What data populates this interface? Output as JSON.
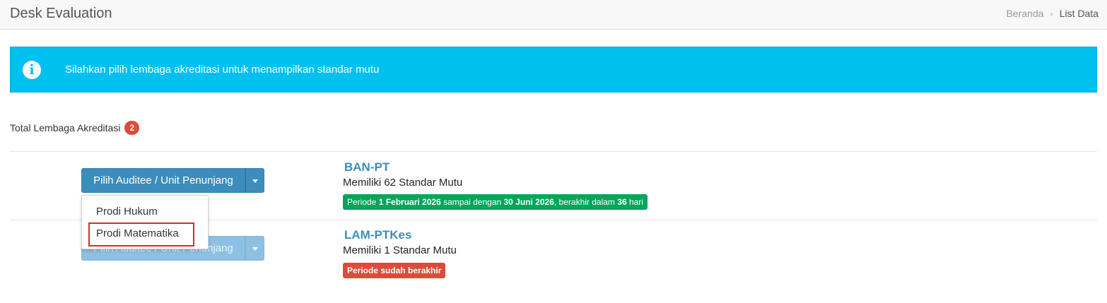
{
  "header": {
    "title": "Desk Evaluation",
    "breadcrumb": {
      "home": "Beranda",
      "separator": "›",
      "current": "List Data"
    }
  },
  "alert": {
    "icon": "info-circle-icon",
    "text": "Silahkan pilih lembaga akreditasi untuk menampilkan standar mutu",
    "color": "#00c0ef"
  },
  "summary": {
    "label": "Total Lembaga Akreditasi",
    "count": "2"
  },
  "rows": [
    {
      "button_label": "Pilih Auditee / Unit Penunjang",
      "name": "BAN-PT",
      "standards": "Memiliki 62 Standar Mutu",
      "period": {
        "prefix": "Periode ",
        "start": "1 Februari 2026",
        "middle": " sampai dengan ",
        "end": "30 Juni 2026",
        "suffix": ", berakhir dalam ",
        "remaining": "36",
        "unit": " hari"
      },
      "badge_color": "#00a65a"
    },
    {
      "button_label": "Pilih Auditee / Unit Penunjang",
      "name": "LAM-PTKes",
      "standards": "Memiliki 1 Standar Mutu",
      "period_text": "Periode sudah berakhir",
      "badge_color": "#dd4b39"
    }
  ],
  "dropdown": {
    "items": [
      "Prodi Hukum",
      "Prodi Matematika"
    ],
    "highlighted": "Prodi Matematika"
  }
}
